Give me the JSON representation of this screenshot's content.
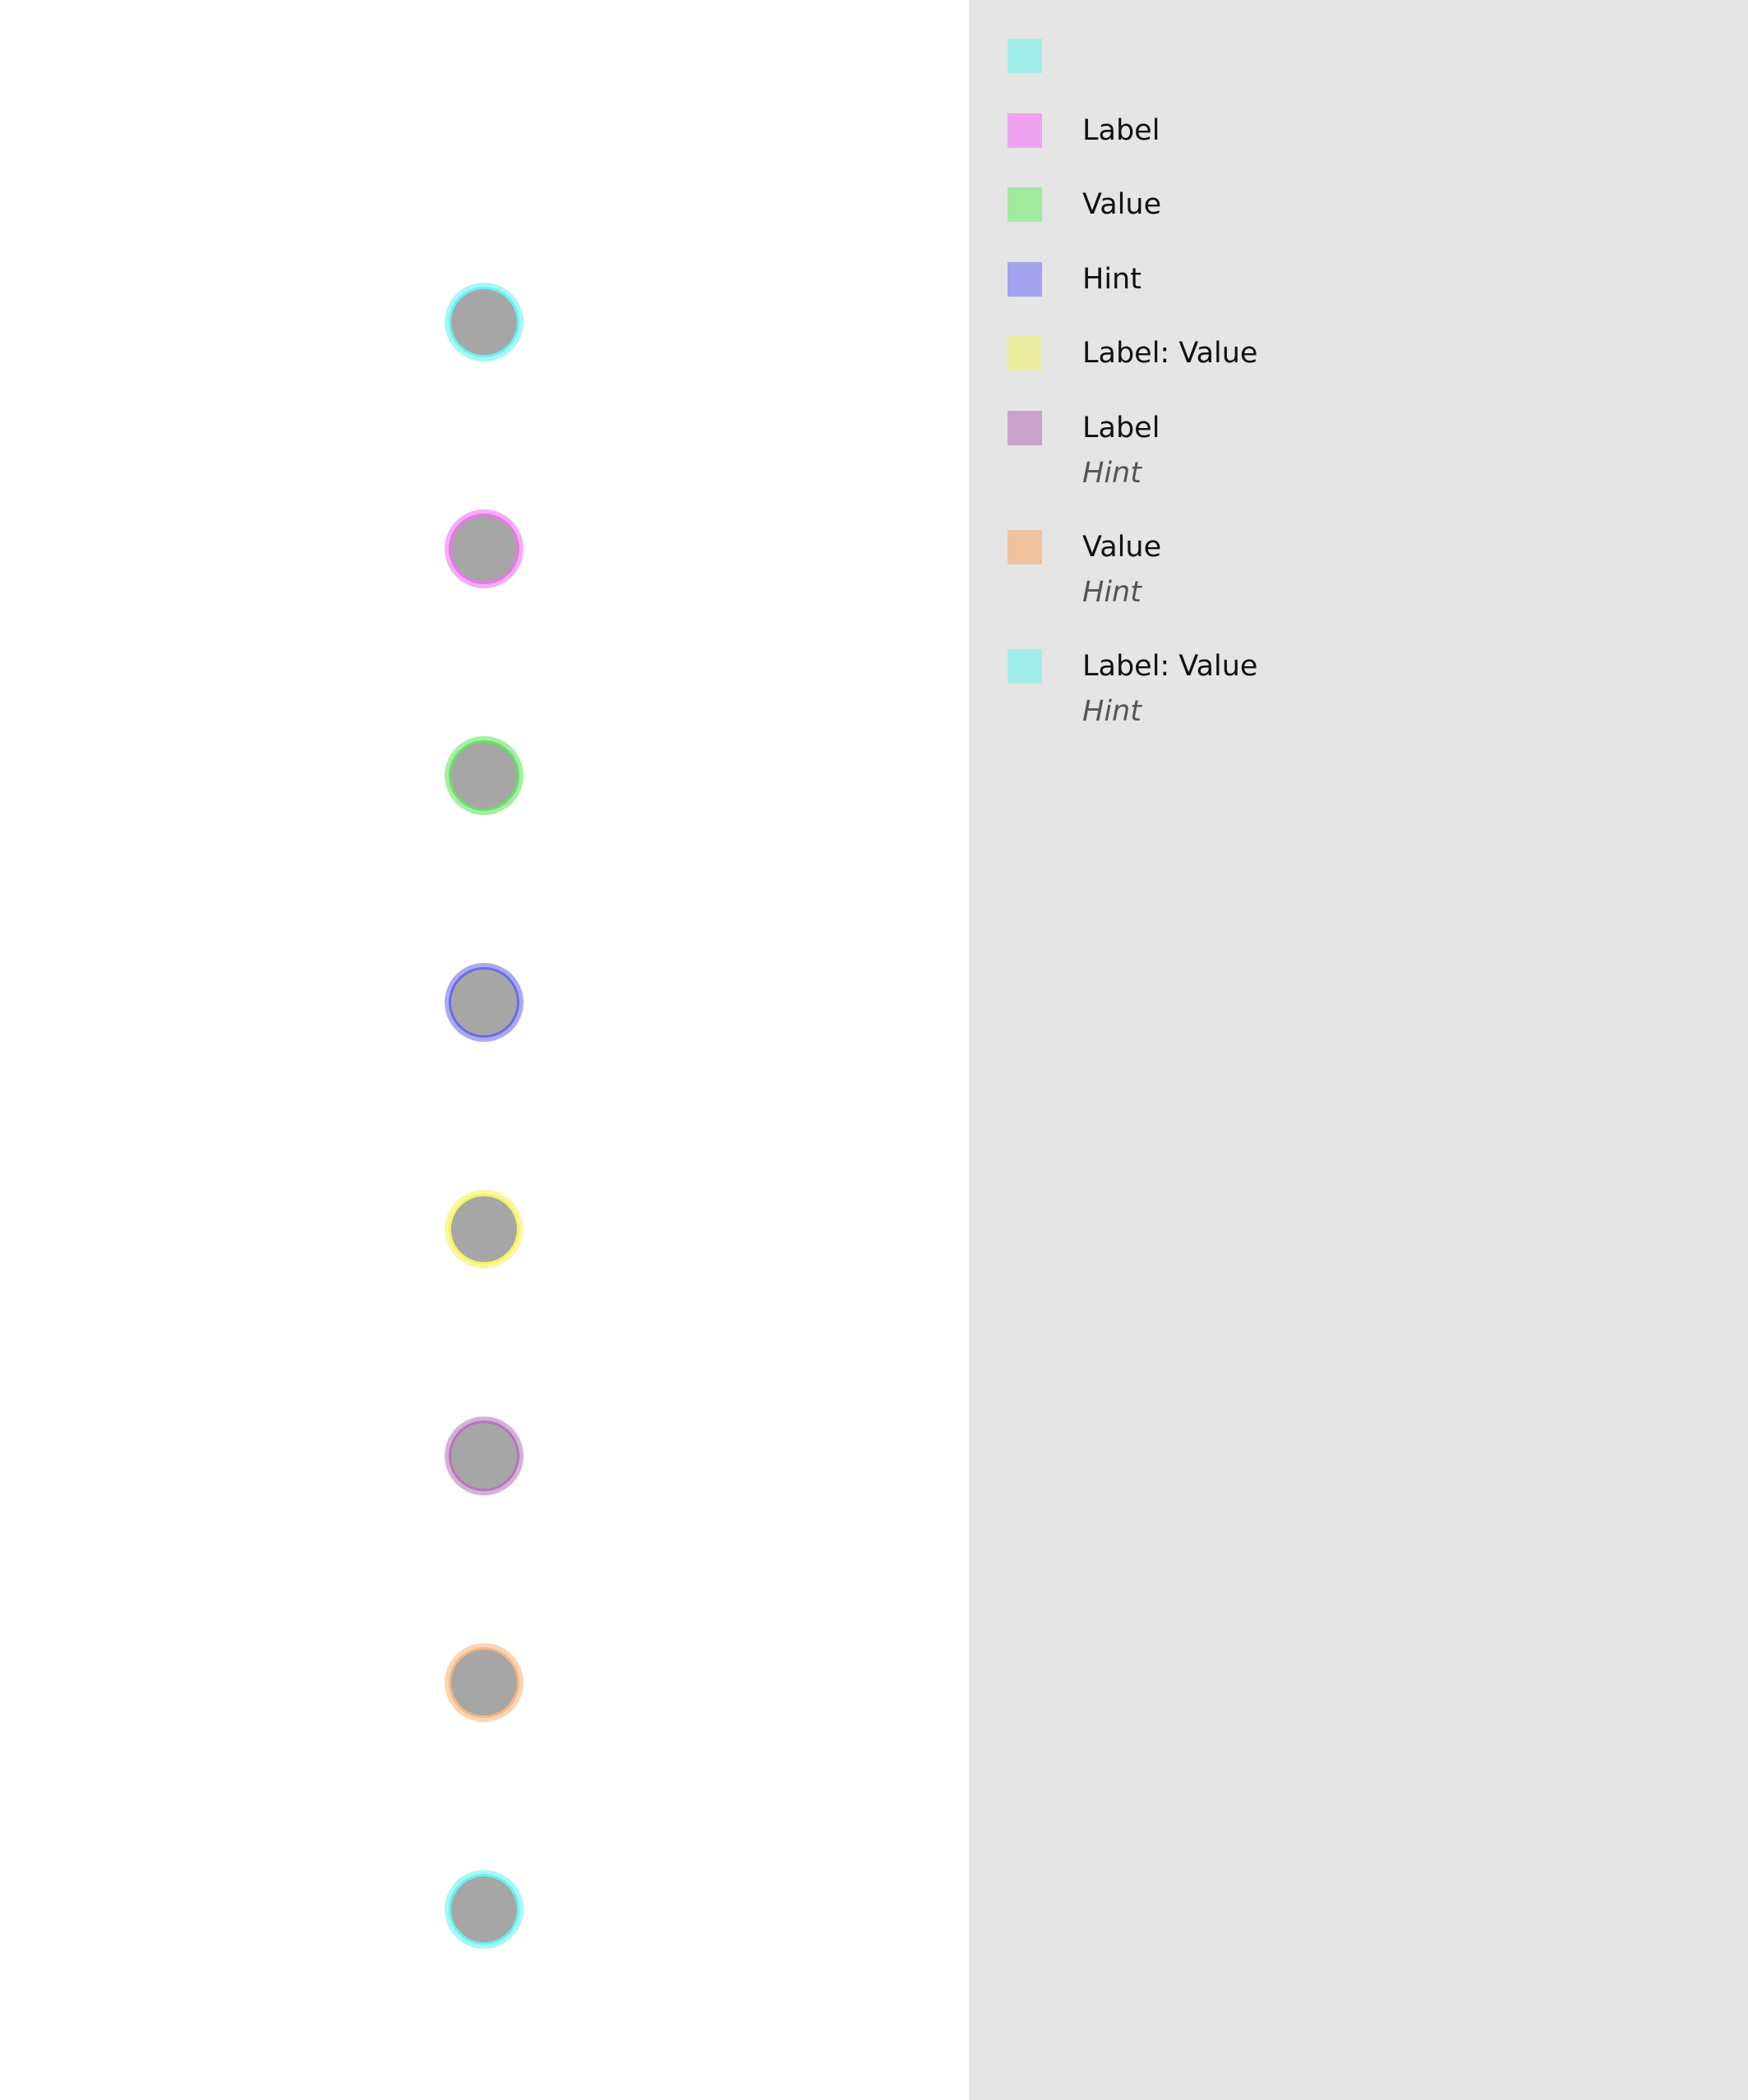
{
  "chart_data": {
    "type": "scatter",
    "title": "",
    "xlabel": "",
    "ylabel": "",
    "grid": false,
    "legend_position": "right",
    "marker_fill": "#a6a6a6",
    "series": [
      {
        "label": "",
        "hint": "",
        "color": "#a3eeea",
        "ring": "#5ff1f1",
        "x": 0,
        "y": 0
      },
      {
        "label": "Label",
        "hint": "",
        "color": "#eda2ee",
        "ring": "#ed6af0",
        "x": 0,
        "y": 1
      },
      {
        "label": "Value",
        "hint": "",
        "color": "#a2eaa0",
        "ring": "#5fe05b",
        "x": 0,
        "y": 2
      },
      {
        "label": "Hint",
        "hint": "",
        "color": "#a3a3ee",
        "ring": "#6464e6",
        "x": 0,
        "y": 3
      },
      {
        "label": "Label: Value",
        "hint": "",
        "color": "#ebeea2",
        "ring": "#f3f35a",
        "x": 0,
        "y": 4
      },
      {
        "label": "Label",
        "hint": "Hint",
        "color": "#c9a3cb",
        "ring": "#b46fb6",
        "x": 0,
        "y": 5
      },
      {
        "label": "Value",
        "hint": "Hint",
        "color": "#efc39f",
        "ring": "#f4b27a",
        "x": 0,
        "y": 6
      },
      {
        "label": "Label: Value",
        "hint": "Hint",
        "color": "#a3eeea",
        "ring": "#5ff1f1",
        "x": 0,
        "y": 7
      }
    ]
  }
}
